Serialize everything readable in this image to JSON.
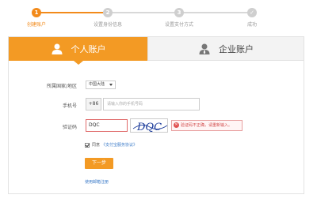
{
  "steps": [
    {
      "number": "1",
      "label": "创建账户"
    },
    {
      "number": "2",
      "label": "设置身份信息"
    },
    {
      "number": "3",
      "label": "设置支付方式"
    },
    {
      "number": "✓",
      "label": "成功"
    }
  ],
  "tabs": {
    "personal": "个人账户",
    "enterprise": "企业账户"
  },
  "form": {
    "region_label": "所属国家/地区",
    "region_value": "中国大陆",
    "phone_label": "手机号",
    "phone_prefix": "+86",
    "phone_placeholder": "请输入你的手机号码",
    "captcha_label": "验证码",
    "captcha_value": "DQC",
    "captcha_image_text": "DQC",
    "captcha_error": "验证码不正确，请重新输入。",
    "agree_text": "同意",
    "agree_link": "《支付宝服务协议》",
    "next_button": "下一步",
    "email_link": "使用邮箱注册"
  },
  "colors": {
    "accent": "#f39a24",
    "error": "#d24b4b",
    "link": "#3a7ac8"
  }
}
